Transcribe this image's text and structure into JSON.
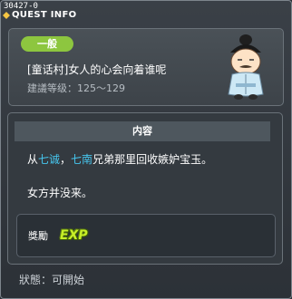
{
  "titlebar": {
    "quest_id": "30427-0",
    "title": "QUEST INFO"
  },
  "header": {
    "category": "一般",
    "quest_name": "[童话村]女人的心会向着谁呢",
    "level_range": "建議等级：125～129"
  },
  "content": {
    "section_title": "内容",
    "desc_part1": "从",
    "desc_name1": "七诚",
    "desc_sep": "，",
    "desc_name2": "七南",
    "desc_part2": "兄弟那里回收嫉妒宝玉。",
    "desc_line2": "女方并没来。"
  },
  "reward": {
    "label": "獎勵",
    "exp_text": "EXP"
  },
  "status": {
    "text": "狀態：可開始"
  },
  "colors": {
    "category_green": "#8dc63f",
    "highlight_cyan": "#46c6ee",
    "exp_yellow_green": "#c7ef27"
  },
  "icons": {
    "title_icon": "quest-diamond-icon",
    "npc": "npc-portrait"
  }
}
